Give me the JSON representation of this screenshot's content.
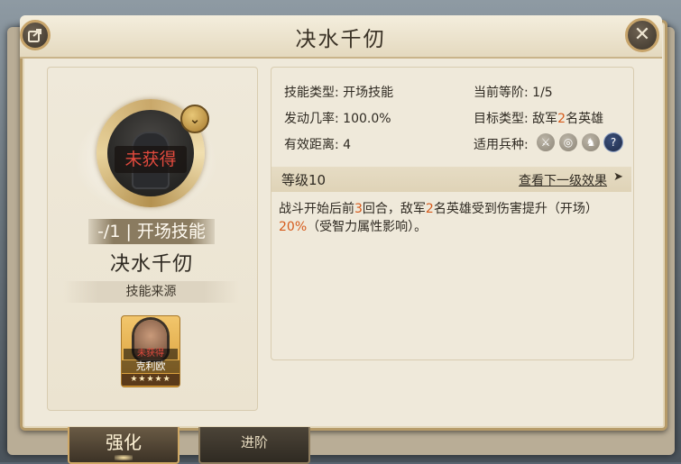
{
  "header": {
    "title": "决水千仞",
    "share_icon": "share-icon",
    "close_icon": "close-icon",
    "close_glyph": "✕"
  },
  "skill": {
    "status": "未获得",
    "level_banner": "-/1 | 开场技能",
    "name": "决水千仞",
    "source_label": "技能来源",
    "badge_icon": "chevron-down-icon",
    "badge_glyph": "⌄"
  },
  "hero": {
    "tag": "未获得",
    "name": "克利欧",
    "stars": "★★★★★",
    "star_count": 5
  },
  "info": {
    "type_label": "技能类型:",
    "type_value": "开场技能",
    "rank_label": "当前等阶:",
    "rank_value": "1/5",
    "rate_label": "发动几率:",
    "rate_value": "100.0%",
    "target_label": "目标类型:",
    "target_pre": "敌军",
    "target_num": "2",
    "target_post": "名英雄",
    "range_label": "有效距离:",
    "range_value": "4",
    "troops_label": "适用兵种:",
    "troop_icons": [
      "sword-icon",
      "shield-icon",
      "horse-icon",
      "question-icon"
    ],
    "troop_glyphs": [
      "⚔",
      "◎",
      "♞",
      "?"
    ]
  },
  "level": {
    "label": "等级10",
    "next_link": "查看下一级效果",
    "arrow": "➤"
  },
  "description": {
    "p1": "战斗开始后前",
    "n1": "3",
    "p2": "回合，敌军",
    "n2": "2",
    "p3": "名英雄受到伤害提升（开场）",
    "n3": "20%",
    "p4": "（受智力属性影响）。"
  },
  "tabs": {
    "enhance": "强化",
    "advance": "进阶"
  },
  "colors": {
    "highlight": "#d65b1c",
    "unobtained": "#e24a3d",
    "frame": "#b69b69",
    "panel": "#efe9da"
  }
}
